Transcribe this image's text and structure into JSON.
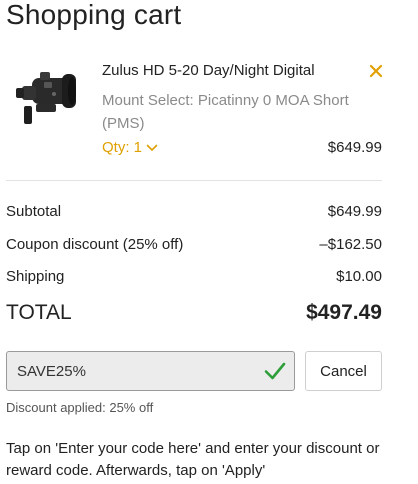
{
  "page_title": "Shopping cart",
  "item": {
    "name": "Zulus HD 5-20 Day/Night Digital",
    "variant": "Mount Select: Picatinny 0 MOA Short (PMS)",
    "qty_label": "Qty: 1",
    "price": "$649.99",
    "image_icon": "night-vision-scope-image",
    "remove_icon": "close-icon"
  },
  "summary": {
    "subtotal_label": "Subtotal",
    "subtotal_value": "$649.99",
    "coupon_label": "Coupon discount (25% off)",
    "coupon_value": "–$162.50",
    "shipping_label": "Shipping",
    "shipping_value": "$10.00",
    "total_label": "TOTAL",
    "total_value": "$497.49"
  },
  "coupon": {
    "value": "SAVE25%",
    "cancel_label": "Cancel",
    "applied_note": "Discount applied: 25% off",
    "check_icon": "checkmark-icon"
  },
  "instructions": "Tap on 'Enter your code here' and enter your discount or reward code. Afterwards, tap on 'Apply'",
  "colors": {
    "accent": "#e0a000",
    "success": "#2e9e3a",
    "muted_text": "#8a8a8a",
    "input_bg": "#ececec"
  }
}
